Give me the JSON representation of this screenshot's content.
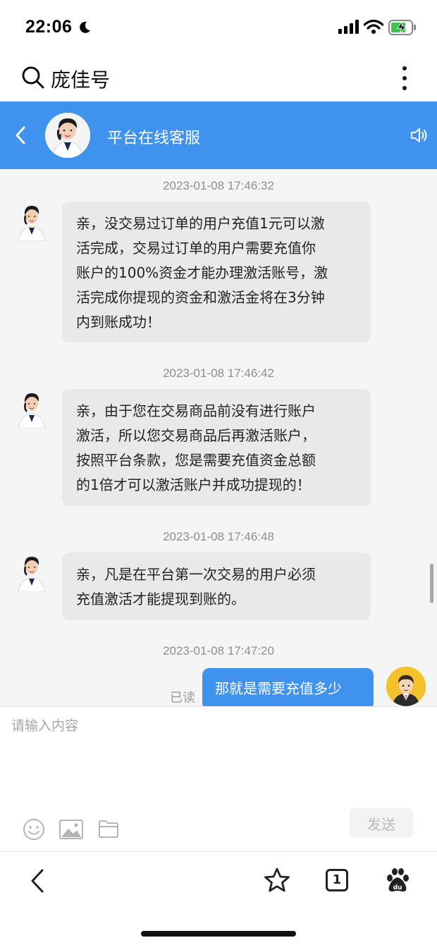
{
  "status_bar": {
    "time": "22:06",
    "icons": [
      "moon-icon",
      "signal-icon",
      "wifi-icon",
      "battery-charging-icon"
    ]
  },
  "search_bar": {
    "query": "庞佳号",
    "icons": [
      "search-icon",
      "more-vertical-icon"
    ]
  },
  "chat_header": {
    "title": "平台在线客服",
    "icons": [
      "back-chevron-icon",
      "speaker-icon"
    ],
    "colors": {
      "header_bg": "#3f93ef"
    }
  },
  "messages": [
    {
      "timestamp": "2023-01-08 17:46:32",
      "sender": "agent",
      "lines": [
        "亲，没交易过订单的用户充值1元可以激",
        "活完成，交易过订单的用户需要充值你",
        "账户的100%资金才能办理激活账号，激",
        "活完成你提现的资金和激活金将在3分钟",
        "内到账成功！"
      ]
    },
    {
      "timestamp": "2023-01-08 17:46:42",
      "sender": "agent",
      "lines": [
        "亲，由于您在交易商品前没有进行账户",
        "激活，所以您交易商品后再激活账户，",
        "按照平台条款，您是需要充值资金总额",
        "的1倍才可以激活账户并成功提现的！"
      ]
    },
    {
      "timestamp": "2023-01-08 17:46:48",
      "sender": "agent",
      "lines": [
        "亲，凡是在平台第一次交易的用户必须",
        "充值激活才能提现到账的。"
      ]
    },
    {
      "timestamp": "2023-01-08 17:47:20",
      "sender": "user",
      "text": "那就是需要充值多少",
      "read_status": "已读"
    }
  ],
  "input": {
    "placeholder": "请输入内容",
    "value": "",
    "send_label": "发送",
    "icons": [
      "emoji-icon",
      "image-icon",
      "folder-icon"
    ]
  },
  "bottom_toolbar": {
    "tab_count": "1",
    "icons": [
      "back-chevron-icon",
      "star-icon",
      "tabs-icon",
      "baidu-paw-icon"
    ]
  }
}
